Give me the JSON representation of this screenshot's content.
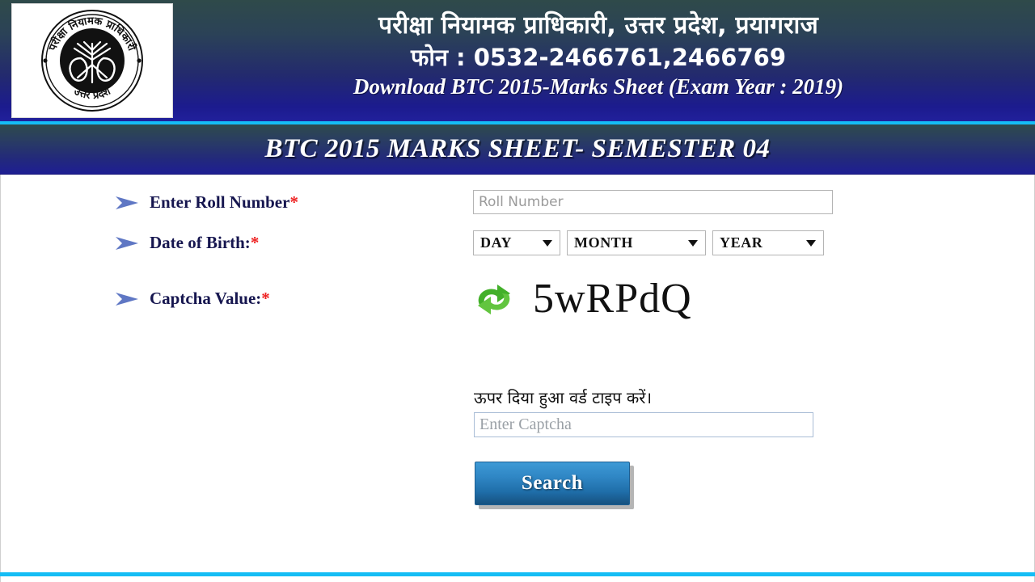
{
  "header": {
    "logo": {
      "icon": "up-exam-authority-seal",
      "top_text": "परीक्षा नियामक प्राधिकारी",
      "bottom_text": "उत्तर प्रदेश"
    },
    "line1": "परीक्षा नियामक प्राधिकारी, उत्तर प्रदेश, प्रयागराज",
    "line2": "फोन : 0532-2466761,2466769",
    "line3": "Download BTC 2015-Marks Sheet (Exam Year : 2019)"
  },
  "titlebar": {
    "title": "BTC 2015 MARKS SHEET- SEMESTER 04"
  },
  "form": {
    "roll": {
      "label": "Enter Roll Number",
      "required_mark": "*",
      "placeholder": "Roll Number",
      "value": ""
    },
    "dob": {
      "label": "Date of Birth:",
      "required_mark": "*",
      "day": "DAY",
      "month": "MONTH",
      "year": "YEAR"
    },
    "captcha": {
      "label": "Captcha Value:",
      "required_mark": "*",
      "refresh_icon": "refresh-icon",
      "code": "5wRPdQ",
      "hint": "ऊपर दिया हुआ वर्ड टाइप करें।",
      "placeholder": "Enter Captcha",
      "value": ""
    },
    "submit": {
      "label": "Search"
    },
    "bullet_icon": "arrow-bullet-icon"
  },
  "colors": {
    "header_gradient_start": "#2f4a4a",
    "header_gradient_end": "#21209b",
    "accent_cyan": "#15bdf5",
    "label_navy": "#16164f",
    "required_red": "#ee2222",
    "captcha_green": "#3faa23",
    "button_blue": "#2f86c4"
  }
}
